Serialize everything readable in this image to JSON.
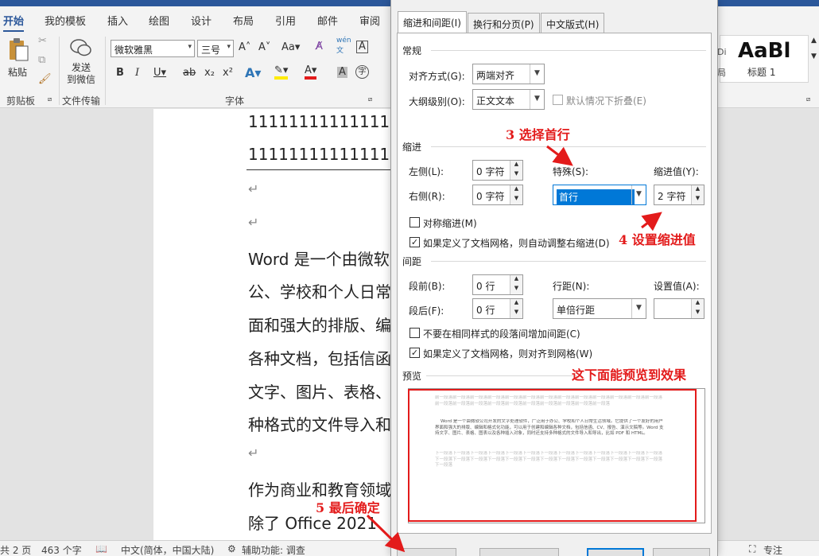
{
  "ribbon": {
    "tabs": [
      "开始",
      "我的模板",
      "插入",
      "绘图",
      "设计",
      "布局",
      "引用",
      "邮件",
      "审阅"
    ],
    "paste_label": "粘贴",
    "send_label": "发送\n到微信",
    "font_name": "微软雅黑",
    "font_size": "三号",
    "group_clipboard": "剪贴板",
    "group_transfer": "文件传输",
    "group_font": "字体",
    "style_preview": "AaBl",
    "style_name": "标题 1",
    "style_small": "Di",
    "style_small2": "局"
  },
  "document": {
    "lines": [
      "11111111111111",
      "11111111111111",
      "Word 是一个由微软",
      "公、学校和个人日常",
      "面和强大的排版、编",
      "各种文档，包括信函",
      "文字、图片、表格、",
      "种格式的文件导入和",
      "作为商业和教育领域",
      "除了 Office 2021"
    ],
    "para_mark": "↵"
  },
  "status": {
    "pages": "共 2 页",
    "words": "463 个字",
    "lang": "中文(简体，中国大陆)",
    "accessibility": "辅助功能: 调查",
    "focus": "专注"
  },
  "dialog": {
    "tabs": [
      "缩进和间距(I)",
      "换行和分页(P)",
      "中文版式(H)"
    ],
    "general": "常规",
    "alignment_label": "对齐方式(G):",
    "alignment_value": "两端对齐",
    "outline_label": "大纲级别(O):",
    "outline_value": "正文文本",
    "collapse_label": "默认情况下折叠(E)",
    "indent": "缩进",
    "left_label": "左侧(L):",
    "left_value": "0 字符",
    "right_label": "右侧(R):",
    "right_value": "0 字符",
    "special_label": "特殊(S):",
    "special_value": "首行",
    "by_label": "缩进值(Y):",
    "by_value": "2 字符",
    "mirror_label": "对称缩进(M)",
    "auto_right_label": "如果定义了文档网格，则自动调整右缩进(D)",
    "spacing": "间距",
    "before_label": "段前(B):",
    "before_value": "0 行",
    "after_label": "段后(F):",
    "after_value": "0 行",
    "line_spacing_label": "行距(N):",
    "line_spacing_value": "单倍行距",
    "at_label": "设置值(A):",
    "at_value": "",
    "no_space_label": "不要在相同样式的段落间增加间距(C)",
    "snap_grid_label": "如果定义了文档网格，则对齐到网格(W)",
    "preview": "预览",
    "preview_prev": "前一段落前一段落前一段落前一段落前一段落前一段落前一段落前一段落前一段落前一段落前一段落前一段落前一段落前一段落前一段落前一段落前一段落前一段落前一段落前一段落前一段落前一段落前一段落",
    "preview_text": "    Word 是一个由微软公司开发的文字处理软件，广泛用于办公、学校和个人日常生活领域。它提供了一个友好的用户界面和强大的排版、编辑和格式化功能，可以用于创建和编辑各种文档，包括信函、CV、报告、演示文稿等。Word 支持文字、图片、表格、图表以及各种插入对象，同时还支持多种格式的文件导入和导出，比如 PDF 和 HTML。",
    "preview_next": "下一段落下一段落下一段落下一段落下一段落下一段落下一段落下一段落下一段落下一段落下一段落下一段落下一段落下一段落下一段落下一段落下一段落下一段落下一段落下一段落下一段落下一段落下一段落下一段落下一段落下一段落下一段落"
  },
  "annotations": {
    "step3": "3 选择首行",
    "step4": "4 设置缩进值",
    "step5": "5 最后确定",
    "preview_note": "这下面能预览到效果",
    "color": "#e31b1b"
  }
}
